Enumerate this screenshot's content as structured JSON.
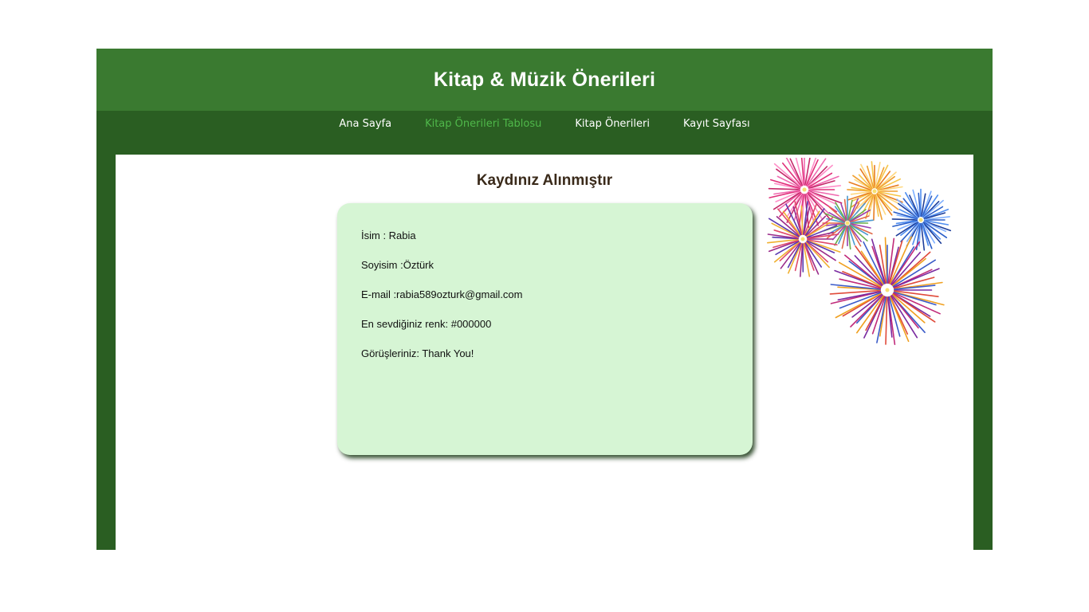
{
  "header": {
    "title": "Kitap & Müzik Önerileri"
  },
  "nav": {
    "items": [
      {
        "label": "Ana Sayfa"
      },
      {
        "label": "Kitap Önerileri Tablosu",
        "active": true
      },
      {
        "label": "Kitap Önerileri"
      },
      {
        "label": "Kayıt Sayfası"
      }
    ]
  },
  "main": {
    "title": "Kaydınız Alınmıştır",
    "fields": [
      {
        "text": "İsim : Rabia"
      },
      {
        "text": "Soyisim :Öztürk"
      },
      {
        "text": "E-mail :rabia589ozturk@gmail.com"
      },
      {
        "text": "En sevdiğiniz renk: #000000"
      },
      {
        "text": "Görüşleriniz: Thank You!"
      }
    ],
    "decoration": {
      "icon": "fireworks-image"
    }
  },
  "colors": {
    "header": "#3a7a30",
    "frame": "#2a5e22",
    "nav_active": "#4fb84a",
    "card": "#d6f5d4",
    "title_text": "#3a2a1a"
  }
}
